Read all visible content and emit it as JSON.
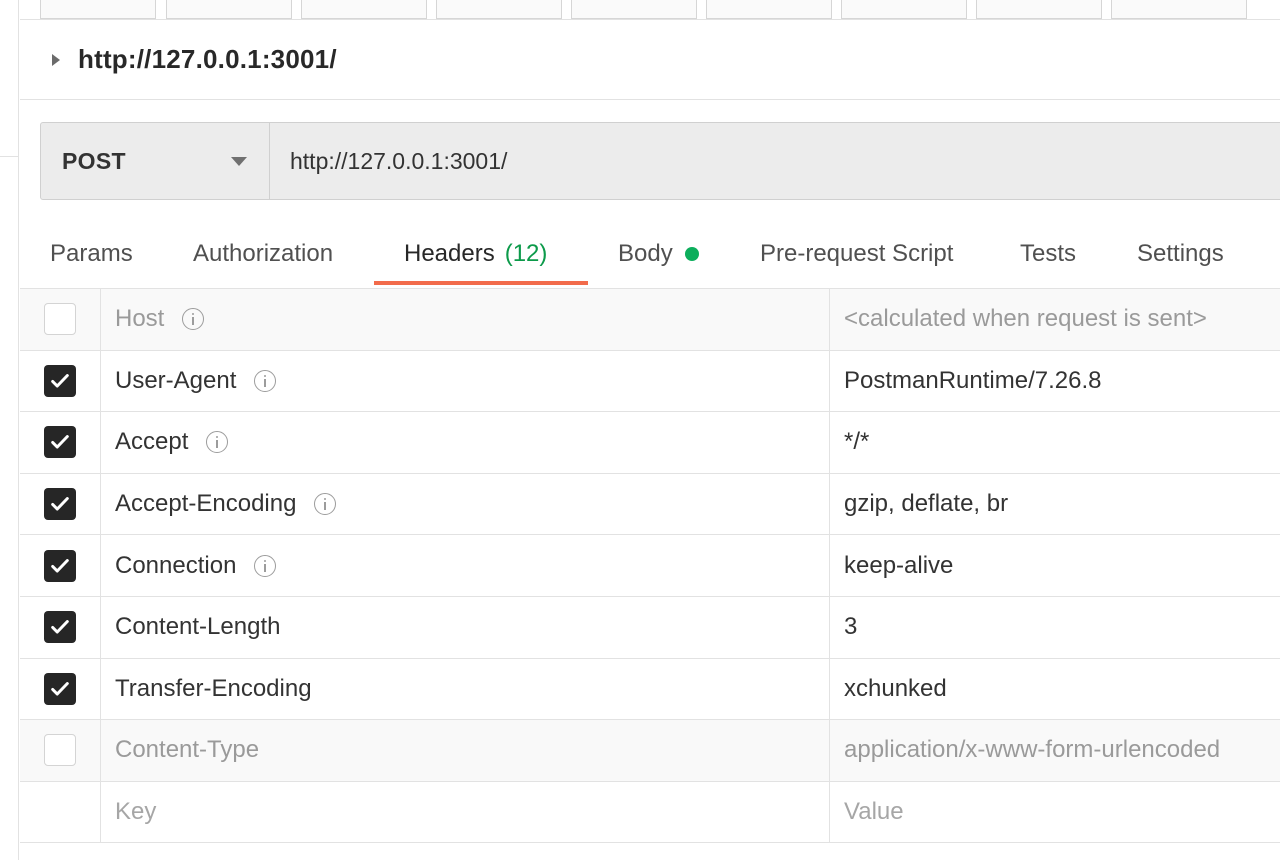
{
  "request": {
    "title": "http://127.0.0.1:3001/",
    "method": "POST",
    "url": "http://127.0.0.1:3001/"
  },
  "tabs": [
    {
      "label": "Params"
    },
    {
      "label": "Authorization"
    },
    {
      "label": "Headers",
      "count": "(12)",
      "active": true
    },
    {
      "label": "Body",
      "indicator": "green-dot"
    },
    {
      "label": "Pre-request Script"
    },
    {
      "label": "Tests"
    },
    {
      "label": "Settings"
    }
  ],
  "headers": {
    "rows": [
      {
        "key": "Host",
        "value": "<calculated when request is sent>",
        "checked": false,
        "info": true
      },
      {
        "key": "User-Agent",
        "value": "PostmanRuntime/7.26.8",
        "checked": true,
        "info": true
      },
      {
        "key": "Accept",
        "value": "*/*",
        "checked": true,
        "info": true
      },
      {
        "key": "Accept-Encoding",
        "value": "gzip, deflate, br",
        "checked": true,
        "info": true
      },
      {
        "key": "Connection",
        "value": "keep-alive",
        "checked": true,
        "info": true
      },
      {
        "key": "Content-Length",
        "value": "3",
        "checked": true,
        "info": false
      },
      {
        "key": "Transfer-Encoding",
        "value": "xchunked",
        "checked": true,
        "info": false
      },
      {
        "key": "Content-Type",
        "value": "application/x-www-form-urlencoded",
        "checked": false,
        "info": false
      }
    ],
    "new_row": {
      "key_placeholder": "Key",
      "value_placeholder": "Value"
    }
  },
  "colors": {
    "active_tab_underline": "#f26b4b",
    "header_count": "#0c9a4a",
    "body_indicator": "#0cae5c",
    "checkbox_checked": "#262626"
  }
}
